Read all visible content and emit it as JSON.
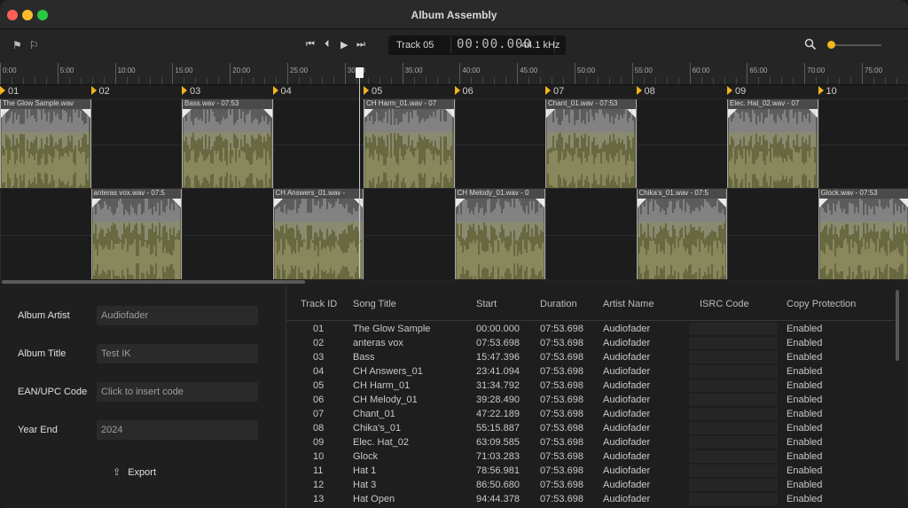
{
  "window": {
    "title": "Album Assembly"
  },
  "transport": {
    "track": "Track 05",
    "timecode": "00:00.000",
    "sample_rate": "44.1 kHz"
  },
  "ruler": [
    "0:00",
    "5:00",
    "10:00",
    "15:00",
    "20:00",
    "25:00",
    "30:00",
    "35:00",
    "40:00",
    "45:00",
    "50:00",
    "55:00",
    "60:00",
    "65:00",
    "70:00",
    "75:00"
  ],
  "markers": [
    "01",
    "02",
    "03",
    "04",
    "05",
    "06",
    "07",
    "08",
    "09",
    "10"
  ],
  "clips_top": [
    "The Glow Sample.wav",
    "Bass.wav - 07:53",
    "CH Harm_01.wav - 07",
    "Chant_01.wav - 07:53",
    "Elec. Hat_02.wav - 07"
  ],
  "clips_bottom": [
    "anteras vox.wav - 07:5",
    "CH Answers_01.wav -",
    "CH Melody_01.wav - 0",
    "Chika's_01.wav - 07:5",
    "Glock.wav - 07:53"
  ],
  "album": {
    "artist_label": "Album Artist",
    "artist_value": "Audiofader",
    "title_label": "Album Title",
    "title_value": "Test IK",
    "ean_label": "EAN/UPC Code",
    "ean_placeholder": "Click to insert code",
    "year_label": "Year End",
    "year_value": "2024",
    "export_label": "Export"
  },
  "table": {
    "headers": [
      "Track ID",
      "Song Title",
      "Start",
      "Duration",
      "Artist Name",
      "ISRC Code",
      "Copy Protection"
    ],
    "rows": [
      [
        "01",
        "The Glow Sample",
        "00:00.000",
        "07:53.698",
        "Audiofader",
        "",
        "Enabled"
      ],
      [
        "02",
        "anteras vox",
        "07:53.698",
        "07:53.698",
        "Audiofader",
        "",
        "Enabled"
      ],
      [
        "03",
        "Bass",
        "15:47.396",
        "07:53.698",
        "Audiofader",
        "",
        "Enabled"
      ],
      [
        "04",
        "CH Answers_01",
        "23:41.094",
        "07:53.698",
        "Audiofader",
        "",
        "Enabled"
      ],
      [
        "05",
        "CH Harm_01",
        "31:34.792",
        "07:53.698",
        "Audiofader",
        "",
        "Enabled"
      ],
      [
        "06",
        "CH Melody_01",
        "39:28.490",
        "07:53.698",
        "Audiofader",
        "",
        "Enabled"
      ],
      [
        "07",
        "Chant_01",
        "47:22.189",
        "07:53.698",
        "Audiofader",
        "",
        "Enabled"
      ],
      [
        "08",
        "Chika's_01",
        "55:15.887",
        "07:53.698",
        "Audiofader",
        "",
        "Enabled"
      ],
      [
        "09",
        "Elec. Hat_02",
        "63:09.585",
        "07:53.698",
        "Audiofader",
        "",
        "Enabled"
      ],
      [
        "10",
        "Glock",
        "71:03.283",
        "07:53.698",
        "Audiofader",
        "",
        "Enabled"
      ],
      [
        "11",
        "Hat 1",
        "78:56.981",
        "07:53.698",
        "Audiofader",
        "",
        "Enabled"
      ],
      [
        "12",
        "Hat 3",
        "86:50.680",
        "07:53.698",
        "Audiofader",
        "",
        "Enabled"
      ],
      [
        "13",
        "Hat Open",
        "94:44.378",
        "07:53.698",
        "Audiofader",
        "",
        "Enabled"
      ]
    ]
  },
  "colors": {
    "accent": "#f2b51a",
    "clip": "#686841"
  },
  "icons": {
    "marker1": "flag-icon",
    "marker2": "flag-icon",
    "search": "search-icon",
    "export": "share-icon"
  }
}
